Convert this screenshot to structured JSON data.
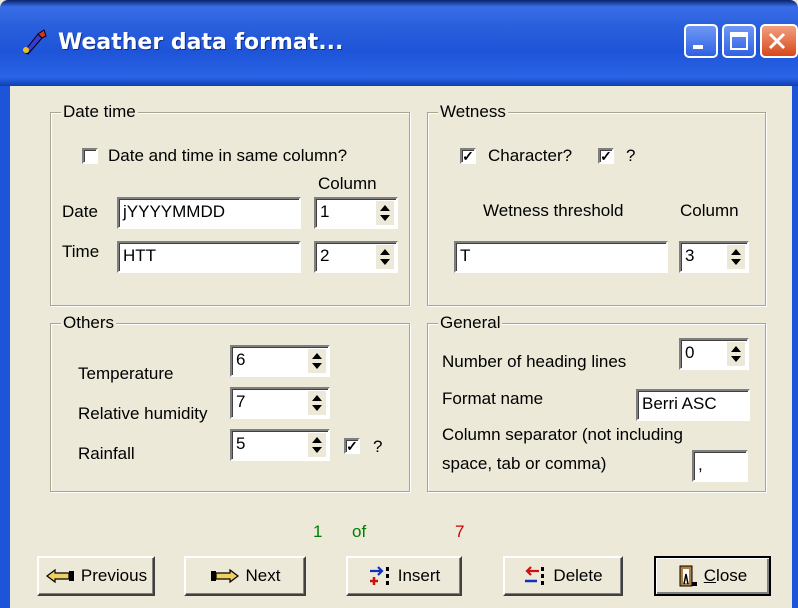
{
  "window": {
    "title": "Weather data format..."
  },
  "datetime": {
    "legend": "Date time",
    "same_column_label": "Date and time in same column?",
    "same_column_checked": false,
    "column_header": "Column",
    "date_label": "Date",
    "date_format": "jYYYYMMDD",
    "date_column": "1",
    "time_label": "Time",
    "time_format": "HTT",
    "time_column": "2"
  },
  "wetness": {
    "legend": "Wetness",
    "character_label": "Character?",
    "character_checked": true,
    "question_label": "?",
    "question_checked": true,
    "threshold_header": "Wetness threshold",
    "column_header": "Column",
    "threshold_value": "T",
    "column_value": "3"
  },
  "others": {
    "legend": "Others",
    "temperature_label": "Temperature",
    "temperature_column": "6",
    "humidity_label": "Relative humidity",
    "humidity_column": "7",
    "rainfall_label": "Rainfall",
    "rainfall_column": "5",
    "rainfall_question_label": "?",
    "rainfall_question_checked": true
  },
  "general": {
    "legend": "General",
    "heading_lines_label": "Number of heading lines",
    "heading_lines_value": "0",
    "format_name_label": "Format name",
    "format_name_value": "Berri ASC",
    "separator_label_line1": "Column separator (not including",
    "separator_label_line2": "space, tab or comma)",
    "separator_value": ","
  },
  "pager": {
    "current": "1",
    "of": "of",
    "total": "7"
  },
  "buttons": {
    "previous": "Previous",
    "next": "Next",
    "insert": "Insert",
    "delete": "Delete",
    "close_prefix": "C",
    "close_rest": "lose"
  },
  "colors": {
    "pager_current": "#008000",
    "pager_of": "#008000",
    "pager_total": "#cc0000"
  }
}
